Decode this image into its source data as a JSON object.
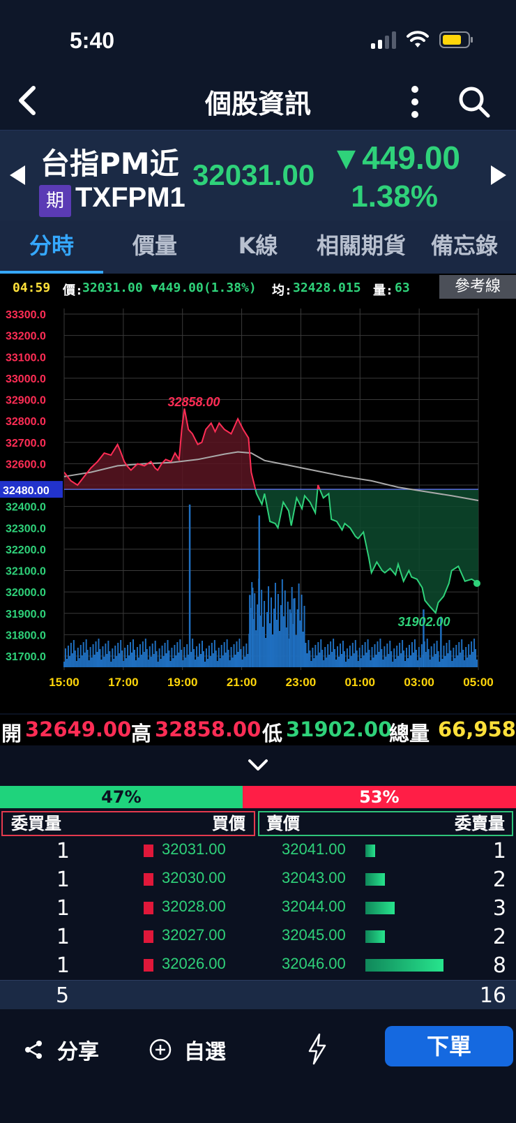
{
  "status_bar": {
    "time": "5:40"
  },
  "nav": {
    "title": "個股資訊"
  },
  "stock": {
    "name": "台指PM近",
    "type_badge": "期",
    "code": "TXFPM1",
    "price": "32031.00",
    "change": "▼449.00",
    "change_pct": "1.38%"
  },
  "tabs": [
    "分時",
    "價量",
    "K線",
    "相關期貨",
    "備忘錄"
  ],
  "infobar": {
    "time": "04:59",
    "price_label": "價:",
    "price_value": "32031.00",
    "change": "▼449.00(1.38%)",
    "avg_label": "均:",
    "avg_value": "32428.015",
    "vol_label": "量:",
    "vol_value": "63",
    "reference_button": "參考線"
  },
  "chart_data": {
    "type": "line",
    "title": "",
    "y_ticks": [
      "33300.0",
      "33200.0",
      "33100.0",
      "33000.0",
      "32900.0",
      "32800.0",
      "32700.0",
      "32600.0",
      "32500.0",
      "32400.0",
      "32300.0",
      "32200.0",
      "32100.0",
      "32000.0",
      "31900.0",
      "31800.0",
      "31700.0"
    ],
    "x_ticks": [
      "15:00",
      "17:00",
      "19:00",
      "21:00",
      "23:00",
      "01:00",
      "03:00",
      "05:00"
    ],
    "ylim": [
      31650,
      33350
    ],
    "reference_price": 32480,
    "reference_label": "32480.00",
    "high_label": "32858.00",
    "low_label": "31902.00",
    "price_series": {
      "hours": [
        0,
        0.5,
        1,
        1.5,
        2,
        2.5,
        3,
        3.5,
        4,
        4.2,
        4.5,
        4.7,
        5,
        5.5,
        6,
        6.5,
        6.8,
        7,
        7.3,
        7.6,
        8,
        8.3,
        8.6,
        8.8,
        9,
        9.3,
        9.6,
        10,
        10.3,
        10.6,
        11,
        11.3,
        11.6,
        12,
        12.5,
        13,
        13.4,
        13.8,
        14,
        14.4,
        14.8,
        15,
        15.4,
        15.8,
        16,
        16.4,
        16.8,
        17,
        17.4,
        17.8,
        18,
        18.4,
        18.8,
        19,
        19.4,
        19.8,
        20,
        20.4,
        20.8,
        21,
        21.4,
        21.8,
        22,
        22.4,
        22.8,
        23,
        23.4,
        23.8,
        24,
        24.4,
        24.8,
        25,
        25.4,
        25.8,
        26,
        26.4,
        26.8,
        27,
        27.4,
        27.8,
        28,
        28.4,
        28.8,
        29,
        29.5,
        30,
        30.5,
        31
      ],
      "values": [
        32560,
        32520,
        32500,
        32540,
        32580,
        32610,
        32650,
        32640,
        32690,
        32660,
        32610,
        32590,
        32570,
        32600,
        32590,
        32610,
        32580,
        32570,
        32600,
        32620,
        32610,
        32650,
        32620,
        32760,
        32858,
        32760,
        32740,
        32690,
        32700,
        32760,
        32790,
        32750,
        32790,
        32760,
        32740,
        32810,
        32760,
        32720,
        32560,
        32460,
        32410,
        32460,
        32330,
        32320,
        32300,
        32420,
        32380,
        32310,
        32440,
        32390,
        32450,
        32420,
        32370,
        32500,
        32440,
        32460,
        32340,
        32330,
        32290,
        32320,
        32300,
        32260,
        32250,
        32280,
        32160,
        32090,
        32140,
        32100,
        32090,
        32110,
        32080,
        32130,
        32050,
        32100,
        32070,
        32060,
        32020,
        31960,
        31930,
        31902,
        31950,
        31980,
        32040,
        32100,
        32120,
        32050,
        32060,
        32040,
        32031
      ]
    },
    "avg_series": {
      "hours": [
        0,
        2,
        4,
        6,
        8,
        10,
        12,
        13,
        14,
        15,
        17,
        19,
        21,
        23,
        25,
        27,
        29,
        31
      ],
      "values": [
        32540,
        32560,
        32590,
        32600,
        32605,
        32620,
        32645,
        32655,
        32650,
        32615,
        32590,
        32565,
        32540,
        32520,
        32490,
        32470,
        32450,
        32428
      ]
    },
    "volume_spikes": [
      {
        "hour": 9.4,
        "level": 0.45
      },
      {
        "hour": 14.6,
        "level": 0.42
      },
      {
        "hour": 14.1,
        "level": 0.22
      },
      {
        "hour": 13.9,
        "level": 0.2
      },
      {
        "hour": 16.9,
        "level": 0.16
      },
      {
        "hour": 17.2,
        "level": 0.19
      },
      {
        "hour": 26.9,
        "level": 0.16
      },
      {
        "hour": 28.2,
        "level": 0.14
      }
    ]
  },
  "ohlc": {
    "open_label": "開",
    "open_value": "32649.00",
    "high_label": "高",
    "high_value": "32858.00",
    "low_label": "低",
    "low_value": "31902.00",
    "total_label": "總量",
    "total_value": "66,958"
  },
  "ratio": {
    "buy": "47%",
    "sell": "53%",
    "buy_fraction": 0.47
  },
  "orderbook": {
    "bid_vol_header": "委買量",
    "bid_price_header": "買價",
    "ask_price_header": "賣價",
    "ask_vol_header": "委賣量",
    "rows": [
      {
        "bid_vol": "1",
        "bid_price": "32031.00",
        "ask_price": "32041.00",
        "ask_vol": "1"
      },
      {
        "bid_vol": "1",
        "bid_price": "32030.00",
        "ask_price": "32043.00",
        "ask_vol": "2"
      },
      {
        "bid_vol": "1",
        "bid_price": "32028.00",
        "ask_price": "32044.00",
        "ask_vol": "3"
      },
      {
        "bid_vol": "1",
        "bid_price": "32027.00",
        "ask_price": "32045.00",
        "ask_vol": "2"
      },
      {
        "bid_vol": "1",
        "bid_price": "32026.00",
        "ask_price": "32046.00",
        "ask_vol": "8"
      }
    ],
    "bid_total": "5",
    "ask_total": "16"
  },
  "footer": {
    "share": "分享",
    "watchlist": "自選",
    "order": "下單"
  },
  "colors": {
    "up": "#ff2d55",
    "down": "#2fd27a",
    "accent": "#35a8ff",
    "volume": "#1f6fc0"
  }
}
